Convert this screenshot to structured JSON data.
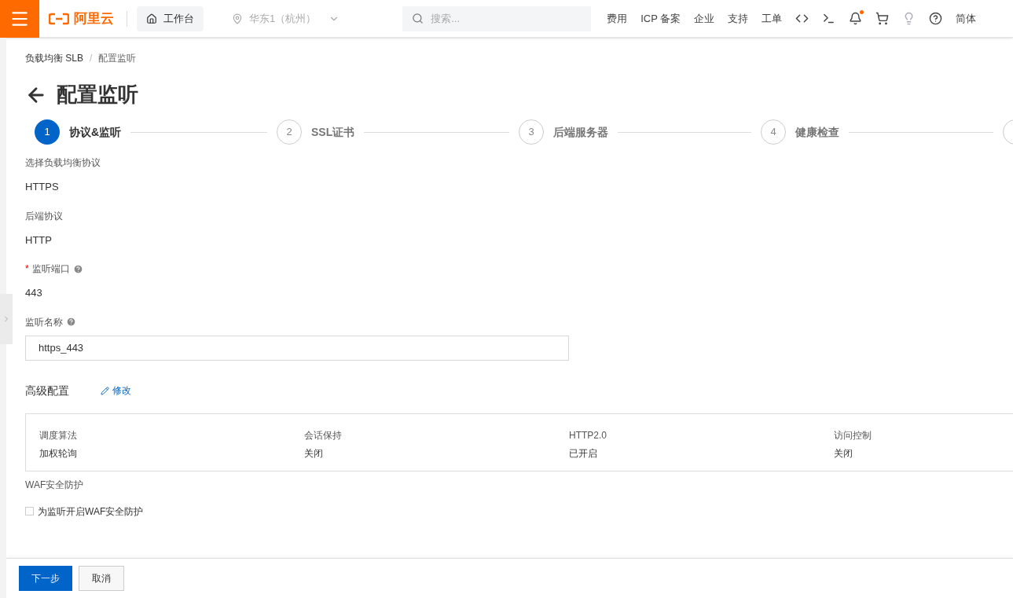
{
  "topbar": {
    "logo": "阿里云",
    "workbench": "工作台",
    "region": {
      "label": "华东1（杭州）",
      "disabled": true
    },
    "search": {
      "placeholder": "搜索..."
    },
    "nav": [
      "费用",
      "ICP 备案",
      "企业",
      "支持",
      "工单"
    ],
    "notification_dot": true,
    "language": "简体"
  },
  "breadcrumb": [
    "负载均衡 SLB",
    "配置监听"
  ],
  "breadcrumb_separator": "/",
  "required_mark": "*",
  "page_title": "配置监听",
  "steps": [
    {
      "number": "1",
      "label": "协议&监听",
      "selected": true
    },
    {
      "number": "2",
      "label": "SSL证书",
      "selected": false
    },
    {
      "number": "3",
      "label": "后端服务器",
      "selected": false
    },
    {
      "number": "4",
      "label": "健康检查",
      "selected": false
    }
  ],
  "fields": [
    {
      "kind": "text",
      "label": "选择负载均衡协议",
      "value": "HTTPS",
      "required": false,
      "help": false
    },
    {
      "kind": "text",
      "label": "后端协议",
      "value": "HTTP",
      "required": false,
      "help": false
    },
    {
      "kind": "text",
      "label": "监听端口",
      "value": "443",
      "required": true,
      "help": true
    },
    {
      "kind": "input",
      "label": "监听名称",
      "value": "https_443",
      "required": false,
      "help": true
    }
  ],
  "advanced": {
    "title": "高级配置",
    "edit_link": "修改",
    "items": [
      {
        "label": "调度算法",
        "value": "加权轮询"
      },
      {
        "label": "会话保持",
        "value": "关闭"
      },
      {
        "label": "HTTP2.0",
        "value": "已开启"
      },
      {
        "label": "访问控制",
        "value": "关闭"
      }
    ]
  },
  "waf": {
    "title": "WAF安全防护",
    "checkbox": {
      "label": "为监听开启WAF安全防护",
      "checked": false
    }
  },
  "footer": {
    "next": "下一步",
    "cancel": "取消"
  }
}
